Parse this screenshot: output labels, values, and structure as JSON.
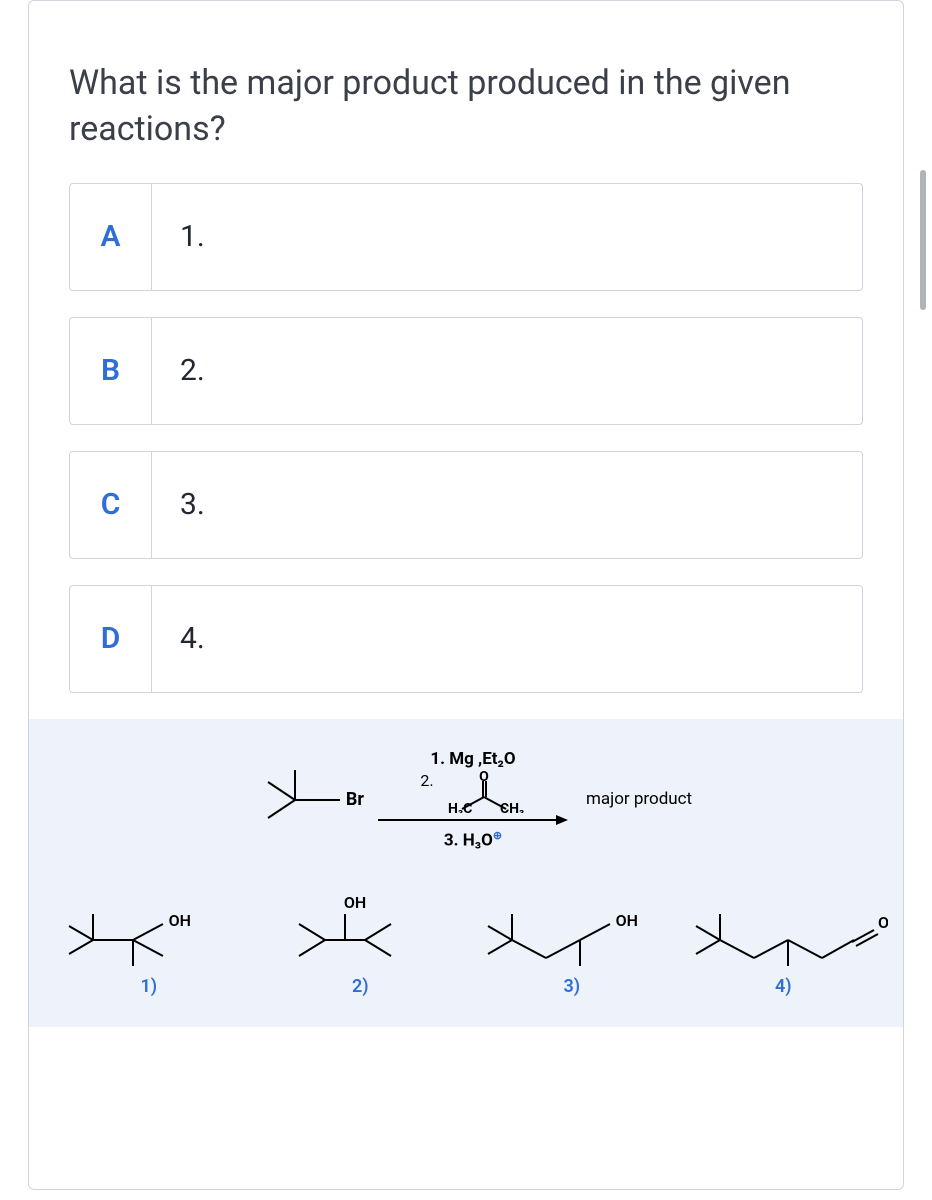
{
  "question": "What is the major product produced in the given reactions?",
  "options": [
    {
      "letter": "A",
      "label": "1."
    },
    {
      "letter": "B",
      "label": "2."
    },
    {
      "letter": "C",
      "label": "3."
    },
    {
      "letter": "D",
      "label": "4."
    }
  ],
  "reaction": {
    "reagent_line1": "1. Mg ,Et₂O",
    "reagent_line2_prefix": "2.",
    "reagent_line2_label_o": "O",
    "ketone_left": "H₃C",
    "ketone_right": "CH₃",
    "reagent_line3_prefix": "3.",
    "reagent_line3_label": "H₃O",
    "reagent_line3_charge": "⊕",
    "start_substituent": "Br",
    "arrow_result": "major product"
  },
  "products": [
    {
      "num": "1)",
      "oh": "OH"
    },
    {
      "num": "2)",
      "oh": "OH"
    },
    {
      "num": "3)",
      "oh": "OH"
    },
    {
      "num": "4)",
      "oh": "O"
    }
  ]
}
